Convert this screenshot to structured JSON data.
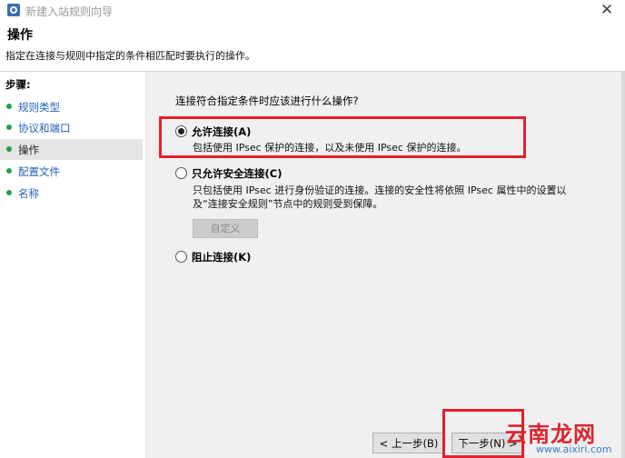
{
  "window": {
    "title": "新建入站规则向导",
    "close_glyph": "✕"
  },
  "header": {
    "title": "操作",
    "description": "指定在连接与规则中指定的条件相匹配时要执行的操作。"
  },
  "sidebar": {
    "title": "步骤:",
    "items": [
      {
        "label": "规则类型",
        "active": false
      },
      {
        "label": "协议和端口",
        "active": false
      },
      {
        "label": "操作",
        "active": true
      },
      {
        "label": "配置文件",
        "active": false
      },
      {
        "label": "名称",
        "active": false
      }
    ]
  },
  "main": {
    "question": "连接符合指定条件时应该进行什么操作?",
    "options": [
      {
        "label": "允许连接(A)",
        "description": "包括使用 IPsec 保护的连接，以及未使用 IPsec 保护的连接。",
        "selected": true
      },
      {
        "label": "只允许安全连接(C)",
        "description": "只包括使用 IPsec 进行身份验证的连接。连接的安全性将依照 IPsec 属性中的设置以及“连接安全规则”节点中的规则受到保障。",
        "selected": false
      },
      {
        "label": "阻止连接(K)",
        "description": "",
        "selected": false
      }
    ],
    "custom_button": "自定义"
  },
  "footer": {
    "back_button": "< 上一步(B)",
    "next_button": "下一步(N) >"
  },
  "watermark": {
    "text": "云南龙网",
    "url": "www.aixiri.com"
  },
  "colors": {
    "highlight": "#e41f2c",
    "link": "#1f5fb7",
    "step_dot": "#21a14a"
  }
}
